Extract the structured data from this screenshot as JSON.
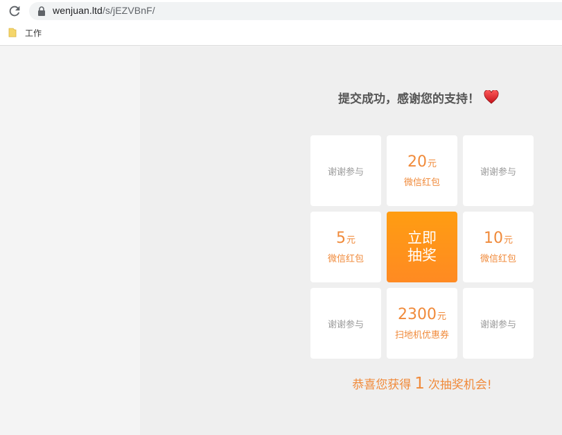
{
  "browser": {
    "url_host": "wenjuan.ltd",
    "url_path": "/s/jEZVBnF/",
    "bookmark_label": "工作",
    "icons": {
      "reload": "reload-icon",
      "lock": "lock-icon",
      "folder": "folder-icon"
    }
  },
  "page": {
    "success_message": "提交成功，感谢您的支持！",
    "heart_icon": "heart-icon",
    "colors": {
      "accent": "#f08a3a",
      "draw_button": "#ff9a14",
      "muted": "#9a9a9a"
    },
    "grid": [
      {
        "type": "thanks",
        "text": "谢谢参与"
      },
      {
        "type": "prize",
        "amount": "20",
        "unit": "元",
        "desc": "微信红包"
      },
      {
        "type": "thanks",
        "text": "谢谢参与"
      },
      {
        "type": "prize",
        "amount": "5",
        "unit": "元",
        "desc": "微信红包"
      },
      {
        "type": "draw",
        "text": "立即抽奖"
      },
      {
        "type": "prize",
        "amount": "10",
        "unit": "元",
        "desc": "微信红包"
      },
      {
        "type": "thanks",
        "text": "谢谢参与"
      },
      {
        "type": "prize",
        "amount": "2300",
        "unit": "元",
        "desc": "扫地机优惠券"
      },
      {
        "type": "thanks",
        "text": "谢谢参与"
      }
    ],
    "chances": {
      "prefix": "恭喜您获得",
      "count": "1",
      "suffix": "次抽奖机会!"
    }
  }
}
